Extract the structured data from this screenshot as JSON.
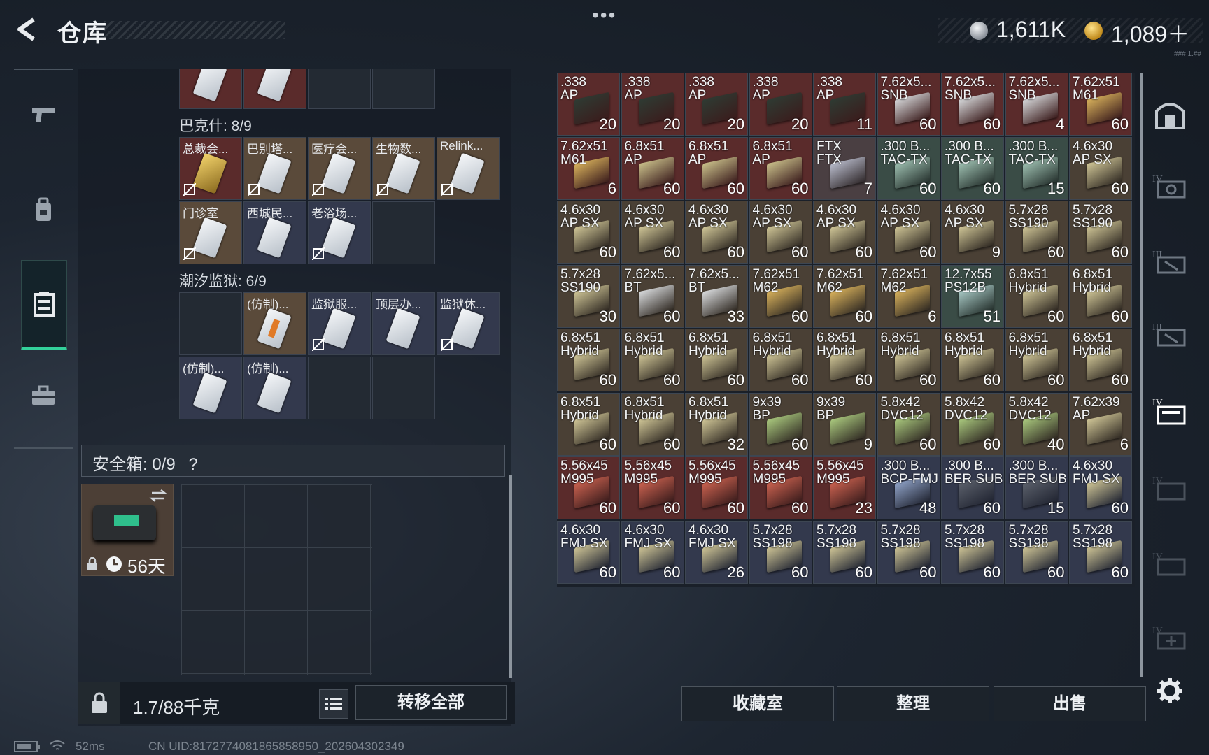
{
  "header": {
    "title": "仓库",
    "more": "•••",
    "currency_silver": "1,611K",
    "currency_gold": "1,089＋",
    "version_text": "### 1.##"
  },
  "backpack": {
    "sections": [
      {
        "label": "巴克什: 8/9"
      },
      {
        "label": "潮汐监狱: 6/9"
      }
    ],
    "bakshi_cards": [
      "总裁会...",
      "巴别塔...",
      "医疗会...",
      "生物数...",
      "Relink...",
      "门诊室",
      "西城民...",
      "老浴场..."
    ],
    "tide_cards": [
      "(仿制)...",
      "监狱服...",
      "顶层办...",
      "监狱休...",
      "(仿制)...",
      "(仿制)..."
    ],
    "safe_label": "安全箱: 0/9",
    "safe_help": "?",
    "safebox_days": "56天",
    "weight": "1.7/88千克",
    "transfer_all": "转移全部"
  },
  "status_bar": {
    "ping": "52ms",
    "uid": "CN UID:8172774081865858950_202604302349"
  },
  "stash": {
    "rows": [
      [
        {
          "t1": ".338",
          "t2": "AP",
          "qty": "20",
          "bg": "#5a2b2b",
          "box": "#2e3b33"
        },
        {
          "t1": ".338",
          "t2": "AP",
          "qty": "20",
          "bg": "#5a2b2b",
          "box": "#2e3b33"
        },
        {
          "t1": ".338",
          "t2": "AP",
          "qty": "20",
          "bg": "#5a2b2b",
          "box": "#2e3b33"
        },
        {
          "t1": ".338",
          "t2": "AP",
          "qty": "20",
          "bg": "#5a2b2b",
          "box": "#2e3b33"
        },
        {
          "t1": ".338",
          "t2": "AP",
          "qty": "11",
          "bg": "#5a2b2b",
          "box": "#2e3b33"
        },
        {
          "t1": "7.62x5...",
          "t2": "SNB",
          "qty": "60",
          "bg": "#5a2b2b",
          "box": "#d8dadc"
        },
        {
          "t1": "7.62x5...",
          "t2": "SNB",
          "qty": "60",
          "bg": "#5a2b2b",
          "box": "#d8dadc"
        },
        {
          "t1": "7.62x5...",
          "t2": "SNB",
          "qty": "4",
          "bg": "#5a2b2b",
          "box": "#d8dadc"
        },
        {
          "t1": "7.62x51",
          "t2": "M61",
          "qty": "60",
          "bg": "#5a2b2b",
          "box": "#d9b25c"
        }
      ],
      [
        {
          "t1": "7.62x51",
          "t2": "M61",
          "qty": "6",
          "bg": "#5a2b2b",
          "box": "#d9b25c"
        },
        {
          "t1": "6.8x51",
          "t2": "AP",
          "qty": "60",
          "bg": "#5a2b2b",
          "box": "#c9bf8a"
        },
        {
          "t1": "6.8x51",
          "t2": "AP",
          "qty": "60",
          "bg": "#5a2b2b",
          "box": "#c9bf8a"
        },
        {
          "t1": "6.8x51",
          "t2": "AP",
          "qty": "60",
          "bg": "#5a2b2b",
          "box": "#c9bf8a"
        },
        {
          "t1": "FTX",
          "t2": "FTX",
          "qty": "7",
          "bg": "#4a3f42",
          "box": "#b9bccc"
        },
        {
          "t1": ".300 B...",
          "t2": "TAC-TX",
          "qty": "60",
          "bg": "#3a4c46",
          "box": "#9dbfb0"
        },
        {
          "t1": ".300 B...",
          "t2": "TAC-TX",
          "qty": "60",
          "bg": "#3a4c46",
          "box": "#9dbfb0"
        },
        {
          "t1": ".300 B...",
          "t2": "TAC-TX",
          "qty": "15",
          "bg": "#3a4c46",
          "box": "#9dbfb0"
        },
        {
          "t1": "4.6x30",
          "t2": "AP SX",
          "qty": "60",
          "bg": "#4a4035",
          "box": "#cfc596"
        }
      ],
      [
        {
          "t1": "4.6x30",
          "t2": "AP SX",
          "qty": "60",
          "bg": "#4a4035",
          "box": "#cfc596"
        },
        {
          "t1": "4.6x30",
          "t2": "AP SX",
          "qty": "60",
          "bg": "#4a4035",
          "box": "#cfc596"
        },
        {
          "t1": "4.6x30",
          "t2": "AP SX",
          "qty": "60",
          "bg": "#4a4035",
          "box": "#cfc596"
        },
        {
          "t1": "4.6x30",
          "t2": "AP SX",
          "qty": "60",
          "bg": "#4a4035",
          "box": "#cfc596"
        },
        {
          "t1": "4.6x30",
          "t2": "AP SX",
          "qty": "60",
          "bg": "#4a4035",
          "box": "#cfc596"
        },
        {
          "t1": "4.6x30",
          "t2": "AP SX",
          "qty": "60",
          "bg": "#4a4035",
          "box": "#cfc596"
        },
        {
          "t1": "4.6x30",
          "t2": "AP SX",
          "qty": "9",
          "bg": "#4a4035",
          "box": "#cfc596"
        },
        {
          "t1": "5.7x28",
          "t2": "SS190",
          "qty": "60",
          "bg": "#4a4035",
          "box": "#cfc596"
        },
        {
          "t1": "5.7x28",
          "t2": "SS190",
          "qty": "60",
          "bg": "#4a4035",
          "box": "#cfc596"
        }
      ],
      [
        {
          "t1": "5.7x28",
          "t2": "SS190",
          "qty": "30",
          "bg": "#4a4035",
          "box": "#cfc596"
        },
        {
          "t1": "7.62x5...",
          "t2": "BT",
          "qty": "60",
          "bg": "#4a4035",
          "box": "#d8dadc"
        },
        {
          "t1": "7.62x5...",
          "t2": "BT",
          "qty": "33",
          "bg": "#4a4035",
          "box": "#d8dadc"
        },
        {
          "t1": "7.62x51",
          "t2": "M62",
          "qty": "60",
          "bg": "#4a4035",
          "box": "#d9b25c"
        },
        {
          "t1": "7.62x51",
          "t2": "M62",
          "qty": "60",
          "bg": "#4a4035",
          "box": "#d9b25c"
        },
        {
          "t1": "7.62x51",
          "t2": "M62",
          "qty": "6",
          "bg": "#4a4035",
          "box": "#d9b25c"
        },
        {
          "t1": "12.7x55",
          "t2": "PS12B",
          "qty": "51",
          "bg": "#3a4c46",
          "box": "#a7c8c4"
        },
        {
          "t1": "6.8x51",
          "t2": "Hybrid",
          "qty": "60",
          "bg": "#4a4035",
          "box": "#cfc596"
        },
        {
          "t1": "6.8x51",
          "t2": "Hybrid",
          "qty": "60",
          "bg": "#4a4035",
          "box": "#cfc596"
        }
      ],
      [
        {
          "t1": "6.8x51",
          "t2": "Hybrid",
          "qty": "60",
          "bg": "#4a4035",
          "box": "#cfc596"
        },
        {
          "t1": "6.8x51",
          "t2": "Hybrid",
          "qty": "60",
          "bg": "#4a4035",
          "box": "#cfc596"
        },
        {
          "t1": "6.8x51",
          "t2": "Hybrid",
          "qty": "60",
          "bg": "#4a4035",
          "box": "#cfc596"
        },
        {
          "t1": "6.8x51",
          "t2": "Hybrid",
          "qty": "60",
          "bg": "#4a4035",
          "box": "#cfc596"
        },
        {
          "t1": "6.8x51",
          "t2": "Hybrid",
          "qty": "60",
          "bg": "#4a4035",
          "box": "#cfc596"
        },
        {
          "t1": "6.8x51",
          "t2": "Hybrid",
          "qty": "60",
          "bg": "#4a4035",
          "box": "#cfc596"
        },
        {
          "t1": "6.8x51",
          "t2": "Hybrid",
          "qty": "60",
          "bg": "#4a4035",
          "box": "#cfc596"
        },
        {
          "t1": "6.8x51",
          "t2": "Hybrid",
          "qty": "60",
          "bg": "#4a4035",
          "box": "#cfc596"
        },
        {
          "t1": "6.8x51",
          "t2": "Hybrid",
          "qty": "60",
          "bg": "#4a4035",
          "box": "#cfc596"
        }
      ],
      [
        {
          "t1": "6.8x51",
          "t2": "Hybrid",
          "qty": "60",
          "bg": "#4a4035",
          "box": "#cfc596"
        },
        {
          "t1": "6.8x51",
          "t2": "Hybrid",
          "qty": "60",
          "bg": "#4a4035",
          "box": "#cfc596"
        },
        {
          "t1": "6.8x51",
          "t2": "Hybrid",
          "qty": "32",
          "bg": "#4a4035",
          "box": "#cfc596"
        },
        {
          "t1": "9x39",
          "t2": "BP",
          "qty": "60",
          "bg": "#4a4035",
          "box": "#a9c87d"
        },
        {
          "t1": "9x39",
          "t2": "BP",
          "qty": "9",
          "bg": "#4a4035",
          "box": "#a9c87d"
        },
        {
          "t1": "5.8x42",
          "t2": "DVC12",
          "qty": "60",
          "bg": "#4a4035",
          "box": "#a9c87d"
        },
        {
          "t1": "5.8x42",
          "t2": "DVC12",
          "qty": "60",
          "bg": "#4a4035",
          "box": "#a9c87d"
        },
        {
          "t1": "5.8x42",
          "t2": "DVC12",
          "qty": "40",
          "bg": "#4a4035",
          "box": "#a9c87d"
        },
        {
          "t1": "7.62x39",
          "t2": "AP",
          "qty": "6",
          "bg": "#4a4035",
          "box": "#cfc596"
        }
      ],
      [
        {
          "t1": "5.56x45",
          "t2": "M995",
          "qty": "60",
          "bg": "#5a2b2b",
          "box": "#c9614f"
        },
        {
          "t1": "5.56x45",
          "t2": "M995",
          "qty": "60",
          "bg": "#5a2b2b",
          "box": "#c9614f"
        },
        {
          "t1": "5.56x45",
          "t2": "M995",
          "qty": "60",
          "bg": "#5a2b2b",
          "box": "#c9614f"
        },
        {
          "t1": "5.56x45",
          "t2": "M995",
          "qty": "60",
          "bg": "#5a2b2b",
          "box": "#c9614f"
        },
        {
          "t1": "5.56x45",
          "t2": "M995",
          "qty": "23",
          "bg": "#5a2b2b",
          "box": "#c9614f"
        },
        {
          "t1": ".300 B...",
          "t2": "BCP-FMJ",
          "qty": "48",
          "bg": "#33394d",
          "box": "#8fa2c7"
        },
        {
          "t1": ".300 B...",
          "t2": "BER SUB",
          "qty": "60",
          "bg": "#33394d",
          "box": "#5a5f6a"
        },
        {
          "t1": ".300 B...",
          "t2": "BER SUB",
          "qty": "15",
          "bg": "#33394d",
          "box": "#5a5f6a"
        },
        {
          "t1": "4.6x30",
          "t2": "FMJ SX",
          "qty": "60",
          "bg": "#33394d",
          "box": "#cfc596"
        }
      ],
      [
        {
          "t1": "4.6x30",
          "t2": "FMJ SX",
          "qty": "60",
          "bg": "#33394d",
          "box": "#cfc596"
        },
        {
          "t1": "4.6x30",
          "t2": "FMJ SX",
          "qty": "60",
          "bg": "#33394d",
          "box": "#cfc596"
        },
        {
          "t1": "4.6x30",
          "t2": "FMJ SX",
          "qty": "26",
          "bg": "#33394d",
          "box": "#cfc596"
        },
        {
          "t1": "5.7x28",
          "t2": "SS198",
          "qty": "60",
          "bg": "#33394d",
          "box": "#cfc596"
        },
        {
          "t1": "5.7x28",
          "t2": "SS198",
          "qty": "60",
          "bg": "#33394d",
          "box": "#cfc596"
        },
        {
          "t1": "5.7x28",
          "t2": "SS198",
          "qty": "60",
          "bg": "#33394d",
          "box": "#cfc596"
        },
        {
          "t1": "5.7x28",
          "t2": "SS198",
          "qty": "60",
          "bg": "#33394d",
          "box": "#cfc596"
        },
        {
          "t1": "5.7x28",
          "t2": "SS198",
          "qty": "60",
          "bg": "#33394d",
          "box": "#cfc596"
        },
        {
          "t1": "5.7x28",
          "t2": "SS198",
          "qty": "60",
          "bg": "#33394d",
          "box": "#cfc596"
        }
      ]
    ]
  },
  "bottom_buttons": {
    "collection": "收藏室",
    "sort": "整理",
    "sell": "出售"
  },
  "colors": {
    "accent_green": "#33d19b"
  }
}
